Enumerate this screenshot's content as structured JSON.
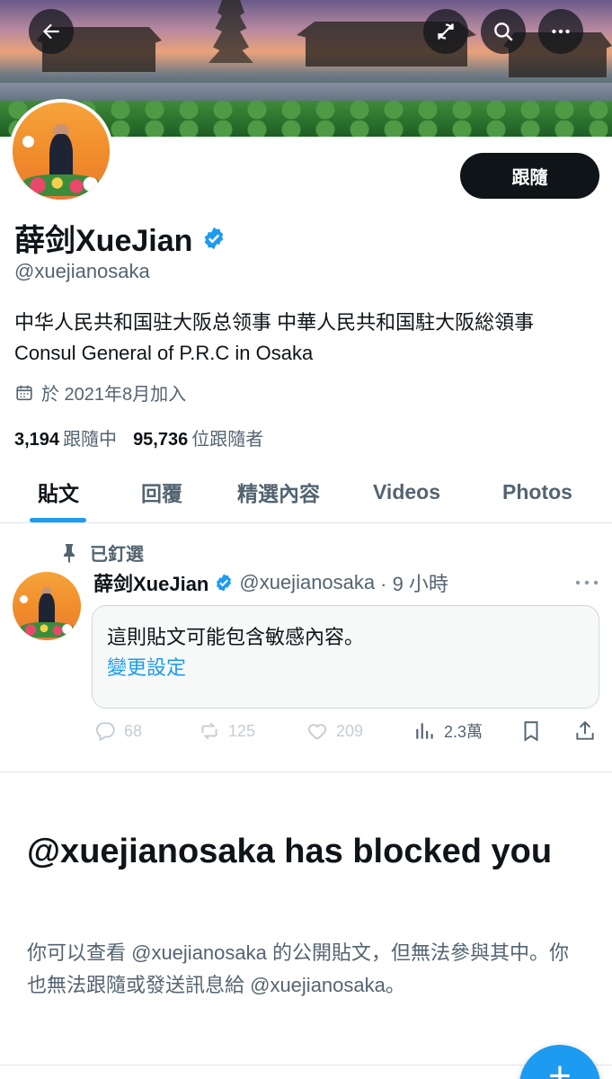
{
  "header": {
    "back_icon": "arrow-left-icon",
    "refresh_icon": "refresh-off-icon",
    "search_icon": "search-icon",
    "more_icon": "more-horizontal-icon"
  },
  "profile": {
    "display_name": "薛剑XueJian",
    "handle": "@xuejianosaka",
    "follow_label": "跟隨",
    "bio": "中华人民共和国驻大阪总领事 中華人民共和国駐大阪総領事 Consul General of P.R.C in Osaka",
    "joined": "於 2021年8月加入",
    "following_count": "3,194",
    "following_label": "跟隨中",
    "followers_count": "95,736",
    "followers_label": "位跟隨者"
  },
  "tabs": [
    {
      "label": "貼文",
      "active": true
    },
    {
      "label": "回覆",
      "active": false
    },
    {
      "label": "精選內容",
      "active": false
    },
    {
      "label": "Videos",
      "active": false
    },
    {
      "label": "Photos",
      "active": false
    }
  ],
  "pinned_post": {
    "pinned_label": "已釘選",
    "author_name": "薛剑XueJian",
    "author_handle": "@xuejianosaka",
    "time": "· 9 小時",
    "sensitive_text": "這則貼文可能包含敏感內容。",
    "change_settings": "變更設定",
    "replies": "68",
    "reposts": "125",
    "likes": "209",
    "views": "2.3萬"
  },
  "blocked": {
    "title": "@xuejianosaka has blocked you",
    "description": "你可以查看 @xuejianosaka 的公開貼文，但無法參與其中。你也無法跟隨或發送訊息給 @xuejianosaka。"
  },
  "fab": {
    "label": "+"
  },
  "colors": {
    "accent": "#1d9bf0",
    "text_primary": "#0f1419",
    "text_secondary": "#536471"
  }
}
